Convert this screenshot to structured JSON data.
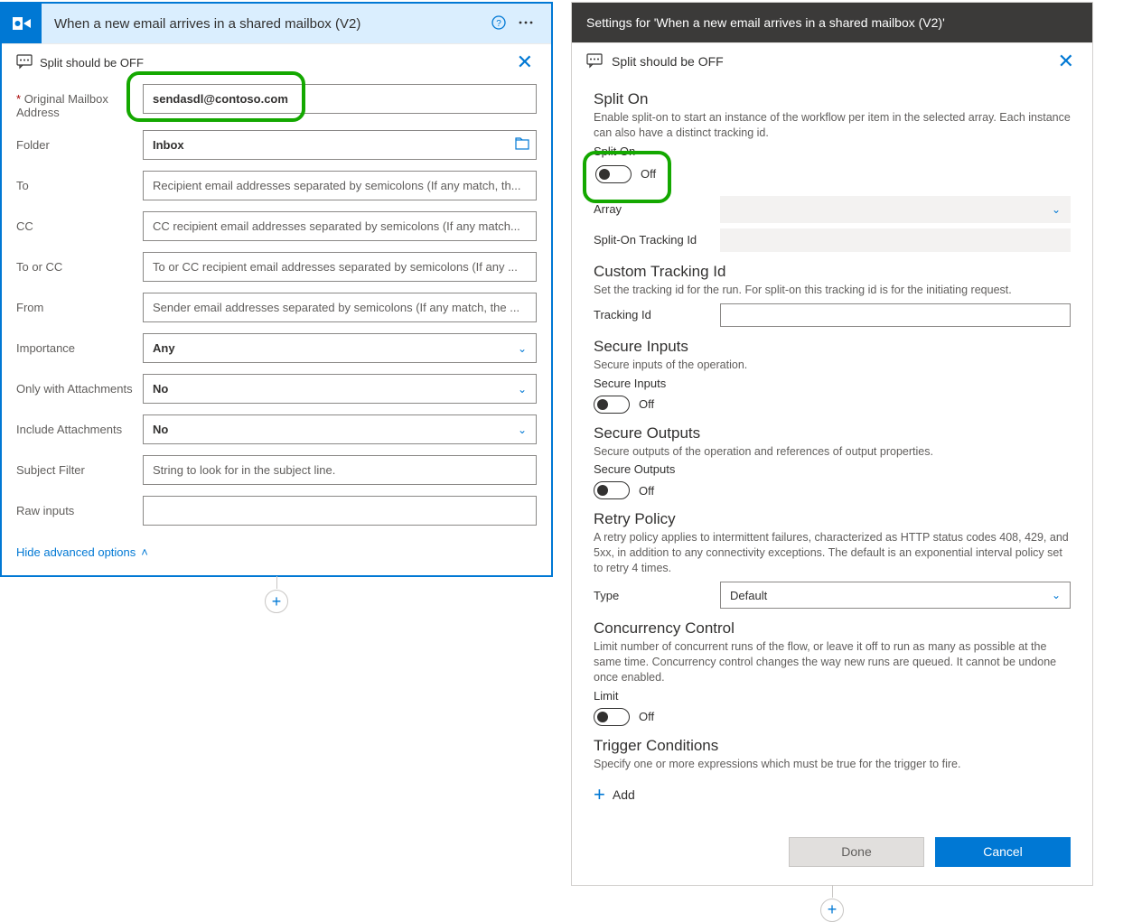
{
  "left": {
    "trigger_title": "When a new email arrives in a shared mailbox (V2)",
    "split_banner_text": "Split should be OFF",
    "fields": {
      "mailbox_label": "Original Mailbox Address",
      "mailbox_value": "sendasdl@contoso.com",
      "folder_label": "Folder",
      "folder_value": "Inbox",
      "to_label": "To",
      "to_placeholder": "Recipient email addresses separated by semicolons (If any match, th...",
      "cc_label": "CC",
      "cc_placeholder": "CC recipient email addresses separated by semicolons (If any match...",
      "tocc_label": "To or CC",
      "tocc_placeholder": "To or CC recipient email addresses separated by semicolons (If any ...",
      "from_label": "From",
      "from_placeholder": "Sender email addresses separated by semicolons (If any match, the ...",
      "importance_label": "Importance",
      "importance_value": "Any",
      "onlyatt_label": "Only with Attachments",
      "onlyatt_value": "No",
      "inclatt_label": "Include Attachments",
      "inclatt_value": "No",
      "subject_label": "Subject Filter",
      "subject_placeholder": "String to look for in the subject line.",
      "raw_label": "Raw inputs"
    },
    "hide_advanced": "Hide advanced options"
  },
  "right": {
    "title": "Settings for 'When a new email arrives in a shared mailbox (V2)'",
    "split_banner_text": "Split should be OFF",
    "split_on_title": "Split On",
    "split_on_desc": "Enable split-on to start an instance of the workflow per item in the selected array. Each instance can also have a distinct tracking id.",
    "split_on_sublabel": "Split On",
    "off_label": "Off",
    "array_label": "Array",
    "split_tracking_label": "Split-On Tracking Id",
    "custom_tracking_title": "Custom Tracking Id",
    "custom_tracking_desc": "Set the tracking id for the run. For split-on this tracking id is for the initiating request.",
    "tracking_id_label": "Tracking Id",
    "secure_in_title": "Secure Inputs",
    "secure_in_desc": "Secure inputs of the operation.",
    "secure_in_sublabel": "Secure Inputs",
    "secure_out_title": "Secure Outputs",
    "secure_out_desc": "Secure outputs of the operation and references of output properties.",
    "secure_out_sublabel": "Secure Outputs",
    "retry_title": "Retry Policy",
    "retry_desc": "A retry policy applies to intermittent failures, characterized as HTTP status codes 408, 429, and 5xx, in addition to any connectivity exceptions. The default is an exponential interval policy set to retry 4 times.",
    "type_label": "Type",
    "type_value": "Default",
    "concur_title": "Concurrency Control",
    "concur_desc": "Limit number of concurrent runs of the flow, or leave it off to run as many as possible at the same time. Concurrency control changes the way new runs are queued. It cannot be undone once enabled.",
    "limit_label": "Limit",
    "trigger_cond_title": "Trigger Conditions",
    "trigger_cond_desc": "Specify one or more expressions which must be true for the trigger to fire.",
    "add_label": "Add",
    "done_label": "Done",
    "cancel_label": "Cancel"
  }
}
